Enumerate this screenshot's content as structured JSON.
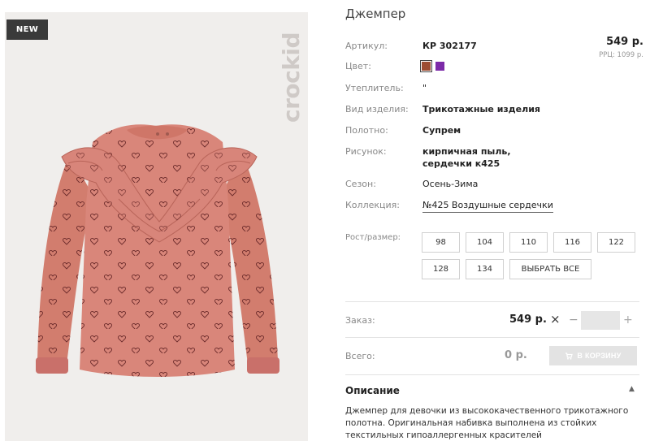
{
  "photo": {
    "badge": "NEW",
    "brand": "crockid"
  },
  "product": {
    "title": "Джемпер",
    "price": "549 р.",
    "rrp_label": "РРЦ: 1099 р.",
    "attributes": [
      {
        "label": "Артикул:",
        "value": "КР 302177"
      },
      {
        "label": "Цвет:",
        "value": ""
      },
      {
        "label": "Утеплитель:",
        "value": "\""
      },
      {
        "label": "Вид изделия:",
        "value": "Трикотажные изделия"
      },
      {
        "label": "Полотно:",
        "value": "Супрем"
      },
      {
        "label": "Рисунок:",
        "value": "кирпичная пыль, сердечки к425"
      },
      {
        "label": "Сезон:",
        "value": "Осень-Зима"
      },
      {
        "label": "Коллекция:",
        "value": "№425 Воздушные сердечки"
      }
    ],
    "colors": [
      "#9d4c32",
      "#7c2aa8"
    ],
    "sizes_label": "Рост/размер:",
    "sizes": [
      "98",
      "104",
      "110",
      "116",
      "122",
      "128",
      "134"
    ],
    "select_all": "ВЫБРАТЬ ВСЕ"
  },
  "order": {
    "label": "Заказ:",
    "price": "549 р.",
    "times": "×",
    "minus": "−",
    "plus": "+",
    "qty": ""
  },
  "total": {
    "label": "Всего:",
    "value": "0 р.",
    "cart_button": "В КОРЗИНУ"
  },
  "description": {
    "title": "Описание",
    "toggle": "▲",
    "text": "Джемпер для девочки из высококачественного трикотажного полотна. Оригинальная набивка выполнена из стойких текстильных гипоаллергенных красителей"
  }
}
